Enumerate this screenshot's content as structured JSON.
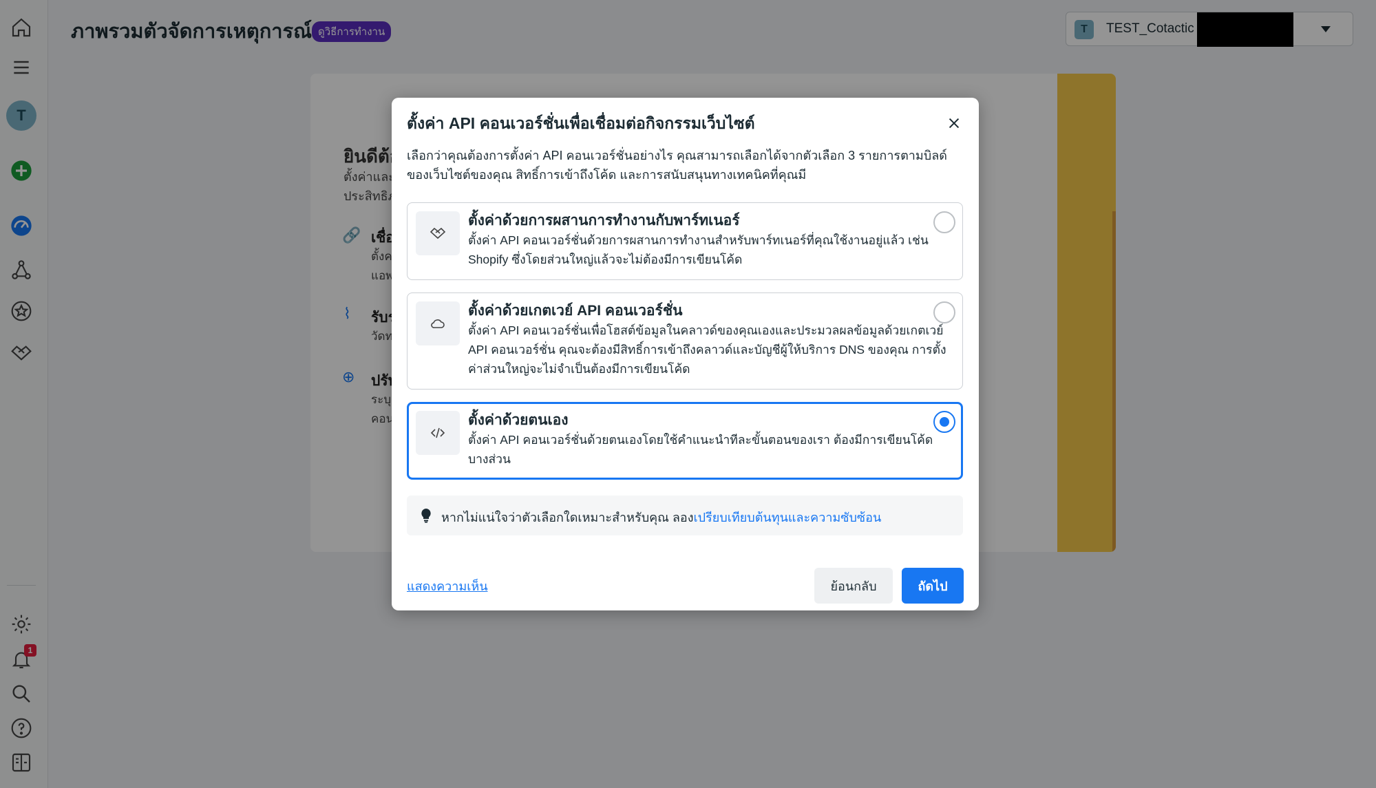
{
  "header": {
    "page_title": "ภาพรวมตัวจัดการเหตุการณ์",
    "badge": "ดูวิธีการทำงาน",
    "account_initial": "T",
    "account_name": "TEST_Cotactic"
  },
  "sidebar": {
    "avatar_initial": "T",
    "notification_count": "1"
  },
  "background": {
    "heading": "ยินดีต้อ",
    "line1": "ตั้งค่าและ",
    "line2": "ประสิทธิภ",
    "item1_title": "เชื่อ",
    "item1_l1": "ตั้งค",
    "item1_l2": "แอพ",
    "item2_title": "รับร",
    "item2_l1": "วัดท",
    "item3_title": "ปรับ",
    "item3_l1": "ระบุ",
    "item3_l2": "คอน"
  },
  "modal": {
    "title": "ตั้งค่า API คอนเวอร์ชั่นเพื่อเชื่อมต่อกิจกรรมเว็บไซต์",
    "description": "เลือกว่าคุณต้องการตั้งค่า API คอนเวอร์ชั่นอย่างไร คุณสามารถเลือกได้จากตัวเลือก 3 รายการตามบิลด์ของเว็บไซต์ของคุณ สิทธิ์การเข้าถึงโค้ด และการสนับสนุนทางเทคนิคที่คุณมี",
    "options": [
      {
        "title": "ตั้งค่าด้วยการผสานการทำงานกับพาร์ทเนอร์",
        "desc": "ตั้งค่า API คอนเวอร์ชั่นด้วยการผสานการทำงานสำหรับพาร์ทเนอร์ที่คุณใช้งานอยู่แล้ว เช่น Shopify ซึ่งโดยส่วนใหญ่แล้วจะไม่ต้องมีการเขียนโค้ด",
        "icon": "handshake-icon",
        "selected": false
      },
      {
        "title": "ตั้งค่าด้วยเกตเวย์ API คอนเวอร์ชั่น",
        "desc": "ตั้งค่า API คอนเวอร์ชั่นเพื่อโฮสต์ข้อมูลในคลาวด์ของคุณเองและประมวลผลข้อมูลด้วยเกตเวย์ API คอนเวอร์ชั่น คุณจะต้องมีสิทธิ์การเข้าถึงคลาวด์และบัญชีผู้ให้บริการ DNS ของคุณ การตั้งค่าส่วนใหญ่จะไม่จำเป็นต้องมีการเขียนโค้ด",
        "icon": "cloud-icon",
        "selected": false
      },
      {
        "title": "ตั้งค่าด้วยตนเอง",
        "desc": "ตั้งค่า API คอนเวอร์ชั่นด้วยตนเองโดยใช้คำแนะนำทีละขั้นตอนของเรา ต้องมีการเขียนโค้ดบางส่วน",
        "icon": "code-icon",
        "selected": true
      }
    ],
    "hint_text": "หากไม่แน่ใจว่าตัวเลือกใดเหมาะสำหรับคุณ ลอง",
    "hint_link": "เปรียบเทียบต้นทุนและความซับซ้อน",
    "feedback_link": "แสดงความเห็น",
    "back_button": "ย้อนกลับ",
    "next_button": "ถัดไป"
  },
  "colors": {
    "accent": "#1877f2",
    "badge": "#5b2ec0",
    "notification": "#e41e3f"
  }
}
